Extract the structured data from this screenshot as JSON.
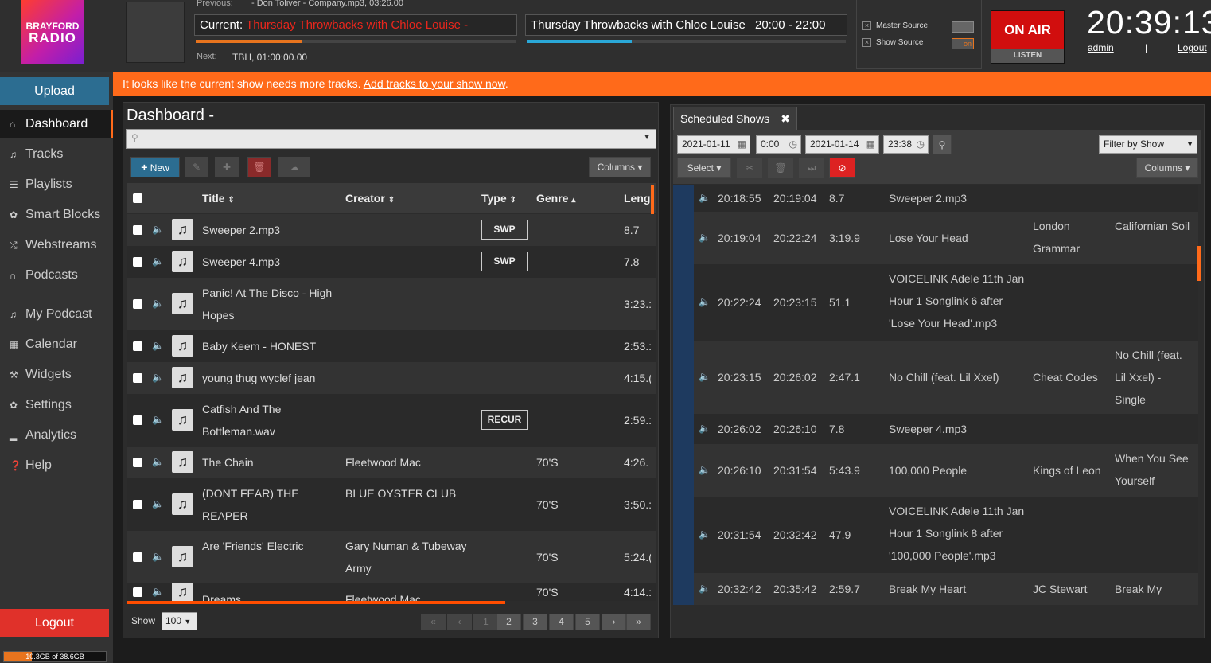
{
  "header": {
    "logo_line1": "BRAYFORD",
    "logo_line2": "RADIO",
    "previous_label": "Previous:",
    "previous_value": "- Don Toliver - Company.mp3, 03:26.00",
    "current_label": "Current:",
    "current_value": "Thursday Throwbacks with Chloe Louise -",
    "current_progress": 0.33,
    "next_label": "Next:",
    "next_value": "TBH, 01:00:00.00",
    "show_name": "Thursday Throwbacks with Chloe Louise",
    "show_time": "20:00 - 22:00",
    "show_progress": 0.33,
    "master_source": "Master Source",
    "show_source": "Show Source",
    "show_source_state": "on",
    "on_air": "ON AIR",
    "listen": "LISTEN",
    "clock": "20:39:13",
    "user": "admin",
    "separator": "|",
    "logout_link": "Logout"
  },
  "sidebar": {
    "upload": "Upload",
    "items": [
      {
        "label": "Dashboard",
        "icon": "home-icon"
      },
      {
        "label": "Tracks",
        "icon": "music-icon"
      },
      {
        "label": "Playlists",
        "icon": "list-icon"
      },
      {
        "label": "Smart Blocks",
        "icon": "gear-icon"
      },
      {
        "label": "Webstreams",
        "icon": "shuffle-icon"
      },
      {
        "label": "Podcasts",
        "icon": "headphones-icon"
      },
      {
        "label": "My Podcast",
        "icon": "music-icon"
      },
      {
        "label": "Calendar",
        "icon": "calendar-icon"
      },
      {
        "label": "Widgets",
        "icon": "wrench-icon"
      },
      {
        "label": "Settings",
        "icon": "gear-icon"
      },
      {
        "label": "Analytics",
        "icon": "bar-chart-icon"
      },
      {
        "label": "Help",
        "icon": "help-icon"
      }
    ],
    "logout": "Logout",
    "disk_usage": "10.3GB of 38.6GB",
    "disk_fraction": 0.27
  },
  "banner": {
    "text": "It looks like the current show needs more tracks.",
    "link": "Add tracks to your show now",
    "suffix": "."
  },
  "dashboard": {
    "title": "Dashboard -",
    "new_button": "New",
    "columns_button": "Columns",
    "columns": [
      "Title",
      "Creator",
      "Type",
      "Genre",
      "Leng"
    ],
    "rows": [
      {
        "title": "Sweeper 2.mp3",
        "creator": "",
        "type": "SWP",
        "genre": "",
        "length": "8.7"
      },
      {
        "title": "Sweeper 4.mp3",
        "creator": "",
        "type": "SWP",
        "genre": "",
        "length": "7.8"
      },
      {
        "title": "Panic! At The Disco - High Hopes",
        "creator": "",
        "type": "",
        "genre": "",
        "length": "3:23.:"
      },
      {
        "title": "Baby Keem - HONEST",
        "creator": "",
        "type": "",
        "genre": "",
        "length": "2:53.:"
      },
      {
        "title": "young thug wyclef jean",
        "creator": "",
        "type": "",
        "genre": "",
        "length": "4:15.("
      },
      {
        "title": "Catfish And The Bottleman.wav",
        "creator": "",
        "type": "RECUR",
        "genre": "",
        "length": "2:59.:"
      },
      {
        "title": "The Chain",
        "creator": "Fleetwood Mac",
        "type": "",
        "genre": "70'S",
        "length": "4:26."
      },
      {
        "title": "(DONT FEAR) THE REAPER",
        "creator": "BLUE OYSTER CLUB",
        "type": "",
        "genre": "70'S",
        "length": "3:50.:"
      },
      {
        "title": "Are 'Friends' Electric",
        "creator": "Gary Numan & Tubeway Army",
        "type": "",
        "genre": "70'S",
        "length": "5:24.("
      },
      {
        "title": "Dreams",
        "creator": "Fleetwood Mac",
        "type": "",
        "genre": "70'S",
        "length": "4:14.:"
      }
    ],
    "show_label": "Show",
    "show_value": "100",
    "pages": [
      "«",
      "‹",
      "1",
      "2",
      "3",
      "4",
      "5",
      "›",
      "»"
    ]
  },
  "scheduled": {
    "tab_title": "Scheduled Shows",
    "start_date": "2021-01-11",
    "start_time": "0:00",
    "end_date": "2021-01-14",
    "end_time": "23:38",
    "filter": "Filter by Show",
    "select_button": "Select",
    "columns_button": "Columns",
    "rows": [
      {
        "start": "20:18:55",
        "end": "20:19:04",
        "length": "8.7",
        "title": "Sweeper 2.mp3",
        "creator": "",
        "album": ""
      },
      {
        "start": "20:19:04",
        "end": "20:22:24",
        "length": "3:19.9",
        "title": "Lose Your Head",
        "creator": "London Grammar",
        "album": "Californian Soil"
      },
      {
        "start": "20:22:24",
        "end": "20:23:15",
        "length": "51.1",
        "title": "VOICELINK Adele 11th Jan Hour 1 Songlink 6 after 'Lose Your Head'.mp3",
        "creator": "",
        "album": ""
      },
      {
        "start": "20:23:15",
        "end": "20:26:02",
        "length": "2:47.1",
        "title": "No Chill (feat. Lil Xxel)",
        "creator": "Cheat Codes",
        "album": "No Chill (feat. Lil Xxel) - Single"
      },
      {
        "start": "20:26:02",
        "end": "20:26:10",
        "length": "7.8",
        "title": "Sweeper 4.mp3",
        "creator": "",
        "album": ""
      },
      {
        "start": "20:26:10",
        "end": "20:31:54",
        "length": "5:43.9",
        "title": "100,000 People",
        "creator": "Kings of Leon",
        "album": "When You See Yourself"
      },
      {
        "start": "20:31:54",
        "end": "20:32:42",
        "length": "47.9",
        "title": "VOICELINK Adele 11th Jan Hour 1 Songlink 8 after '100,000 People'.mp3",
        "creator": "",
        "album": ""
      },
      {
        "start": "20:32:42",
        "end": "20:35:42",
        "length": "2:59.7",
        "title": "Break My Heart",
        "creator": "JC Stewart",
        "album": "Break My"
      }
    ]
  },
  "colors": {
    "accent": "#ff6a1a",
    "onair": "#d10e0e",
    "upload": "#2c6d91",
    "current_show": "#e8261d"
  }
}
